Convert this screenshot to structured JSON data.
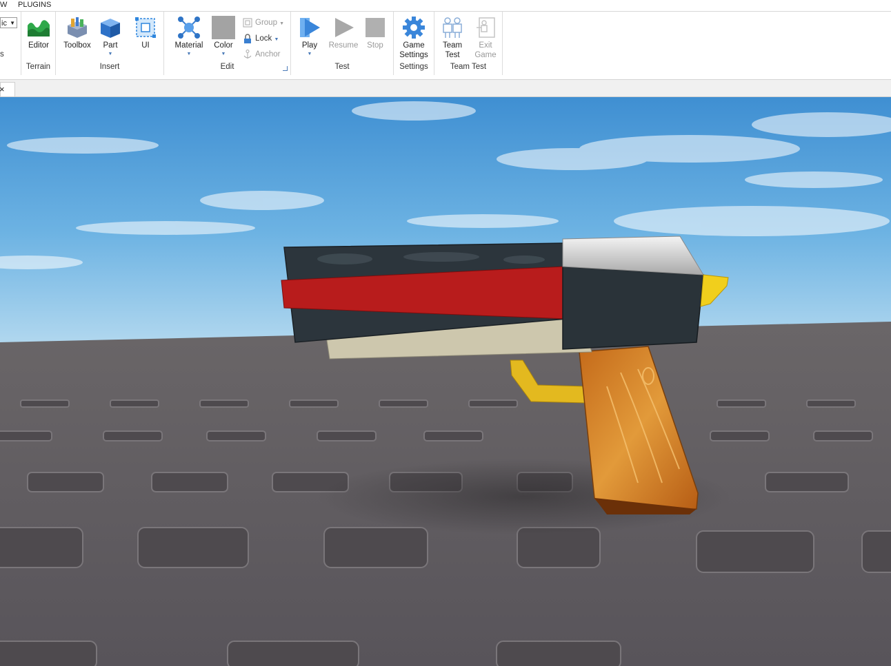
{
  "menu": {
    "items": [
      "W",
      "PLUGINS"
    ]
  },
  "ribbon": {
    "dropdown_value": "ic",
    "side_text": "s",
    "groups": {
      "terrain": {
        "label": "Terrain",
        "editor": "Editor"
      },
      "insert": {
        "label": "Insert",
        "toolbox": "Toolbox",
        "part": "Part",
        "ui": "UI"
      },
      "edit": {
        "label": "Edit",
        "material": "Material",
        "color": "Color",
        "group": "Group",
        "lock": "Lock",
        "anchor": "Anchor"
      },
      "test": {
        "label": "Test",
        "play": "Play",
        "resume": "Resume",
        "stop": "Stop"
      },
      "settings": {
        "label": "Settings",
        "game": "Game",
        "settings": "Settings"
      },
      "teamtest": {
        "label": "Team Test",
        "team": "Team",
        "test": "Test",
        "exit": "Exit",
        "game": "Game"
      }
    }
  },
  "tabs": {
    "close_glyph": "×"
  },
  "colors": {
    "sky_top": "#3d8fd4",
    "sky_bottom": "#a9d3ee",
    "baseplate": "#5e5a5c",
    "accent_blue": "#2d78c8"
  }
}
